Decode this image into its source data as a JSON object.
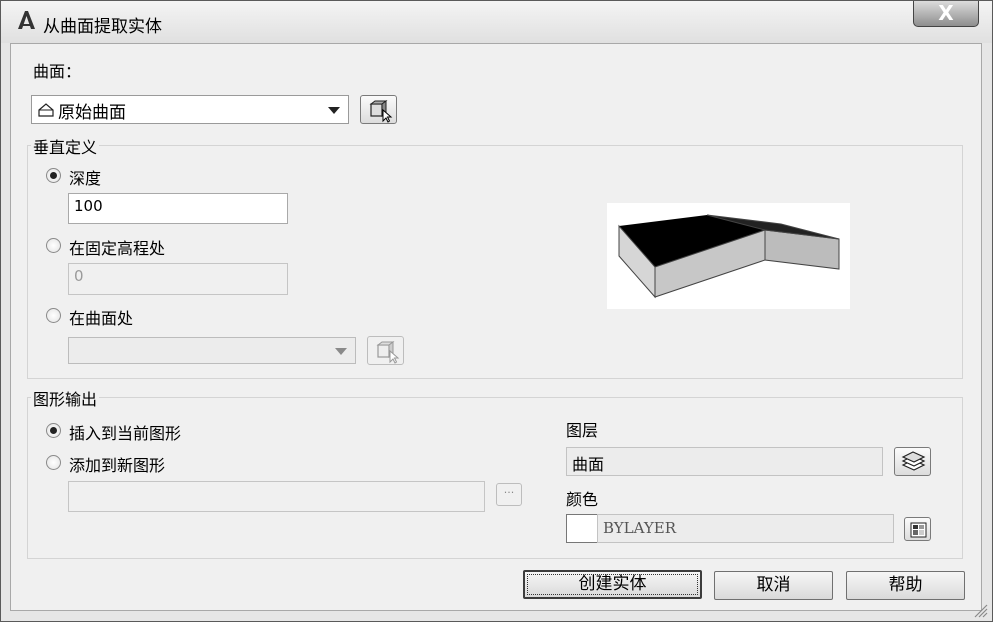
{
  "window": {
    "title": "从曲面提取实体",
    "close_label": "X"
  },
  "surface": {
    "label": "曲面：",
    "selected": "原始曲面"
  },
  "vertical": {
    "group_title": "垂直定义",
    "depth": {
      "label": "深度",
      "value": "100",
      "checked": true
    },
    "elevation": {
      "label": "在固定高程处",
      "value": "0",
      "checked": false
    },
    "at_surface": {
      "label": "在曲面处",
      "selected": "",
      "checked": false
    }
  },
  "output": {
    "group_title": "图形输出",
    "insert_current": {
      "label": "插入到当前图形",
      "checked": true
    },
    "add_new": {
      "label": "添加到新图形",
      "checked": false,
      "path": ""
    },
    "browse_label": "···",
    "layer": {
      "label": "图层",
      "value": "曲面"
    },
    "color": {
      "label": "颜色",
      "value": "BYLAYER",
      "swatch": "#ffffff"
    }
  },
  "buttons": {
    "create": "创建实体",
    "cancel": "取消",
    "help": "帮助"
  },
  "icons": {
    "app": "autocad-icon",
    "surface": "surface-icon",
    "pick": "pick-object-icon",
    "layer": "layers-icon",
    "color": "color-palette-icon"
  }
}
